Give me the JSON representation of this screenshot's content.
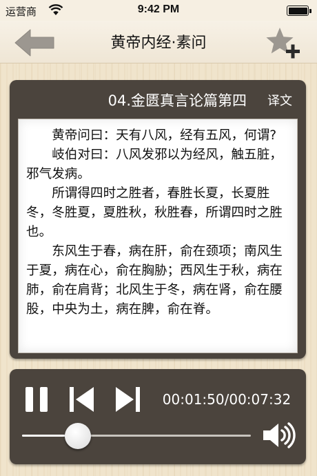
{
  "status_bar": {
    "carrier": "运营商",
    "time": "9:42 PM",
    "battery_level": 1.0
  },
  "nav": {
    "title": "黄帝内经·素问",
    "back_icon": "arrow-left-icon",
    "favorite_icon": "star-plus-icon"
  },
  "chapter": {
    "title": "04.金匮真言论篇第四",
    "translate_label": "译文",
    "paragraphs": [
      "黄帝问曰：天有八风，经有五风，何谓?",
      "岐伯对曰：八风发邪以为经风，触五脏，邪气发病。",
      "所谓得四时之胜者，春胜长夏，长夏胜冬，冬胜夏，夏胜秋，秋胜春，所谓四时之胜也。",
      "东风生于春，病在肝，俞在颈项；南风生于夏，病在心，俞在胸胁；西风生于秋，病在肺，俞在肩背；北风生于冬，病在肾，俞在腰股，中央为土，病在脾，俞在脊。"
    ]
  },
  "player": {
    "time_display": "00:01:50/00:07:32",
    "progress": 0.243,
    "icons": [
      "pause-icon",
      "skip-previous-icon",
      "skip-next-icon",
      "volume-icon"
    ]
  },
  "colors": {
    "panel": "#4b443d",
    "background": "#f0e4cc",
    "nav_bar": "#f7f1e6",
    "icon_gray": "#9c9790"
  }
}
